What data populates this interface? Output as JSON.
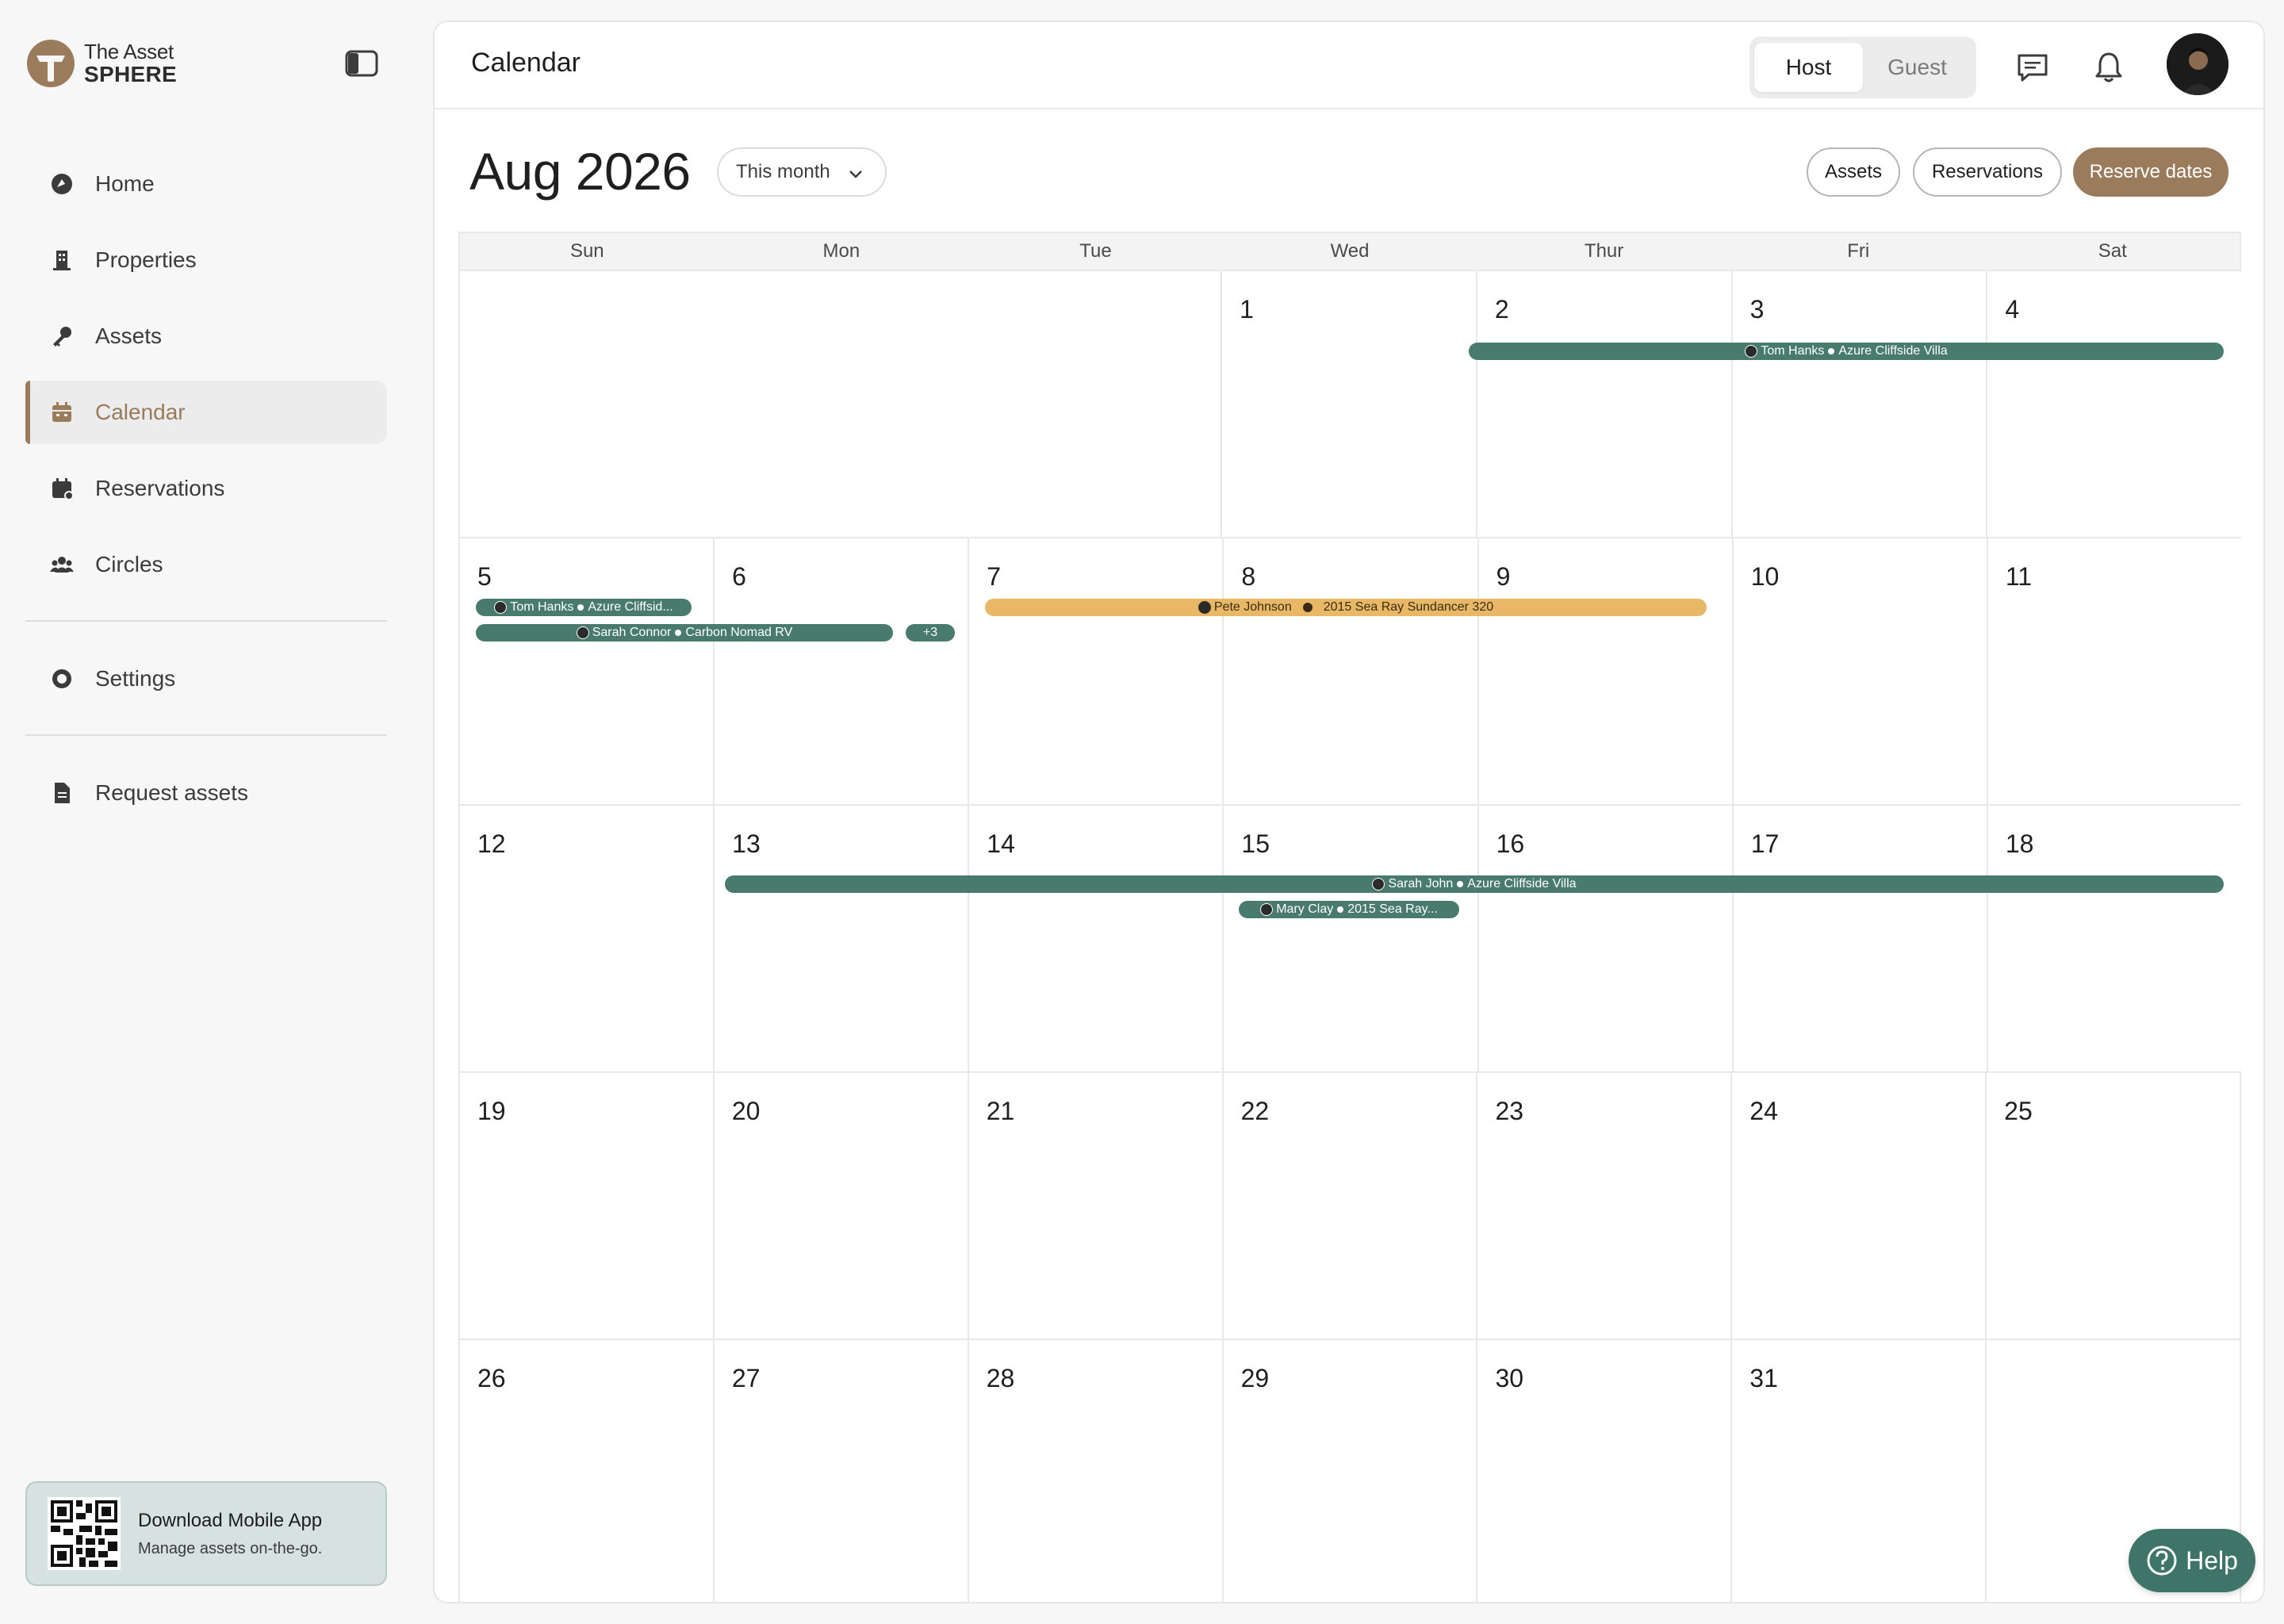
{
  "brand": {
    "line1": "The Asset",
    "line2": "SPHERE",
    "accent": "#9a7b5b"
  },
  "sidebar": {
    "items": [
      {
        "label": "Home",
        "icon": "home-icon"
      },
      {
        "label": "Properties",
        "icon": "building-icon"
      },
      {
        "label": "Assets",
        "icon": "key-icon"
      },
      {
        "label": "Calendar",
        "icon": "calendar-icon",
        "active": true
      },
      {
        "label": "Reservations",
        "icon": "calendar-check-icon"
      },
      {
        "label": "Circles",
        "icon": "users-icon"
      },
      {
        "label": "Settings",
        "icon": "gear-icon"
      },
      {
        "label": "Request assets",
        "icon": "document-icon"
      }
    ],
    "app_card": {
      "title": "Download Mobile App",
      "subtitle": "Manage assets on-the-go."
    }
  },
  "header": {
    "title": "Calendar",
    "mode_toggle": {
      "options": [
        "Host",
        "Guest"
      ],
      "selected": "Host"
    }
  },
  "toolbar": {
    "month_title": "Aug 2026",
    "period_select": "This month",
    "assets_label": "Assets",
    "reservations_label": "Reservations",
    "reserve_label": "Reserve dates"
  },
  "calendar": {
    "weekdays": [
      "Sun",
      "Mon",
      "Tue",
      "Wed",
      "Thur",
      "Fri",
      "Sat"
    ],
    "weeks": [
      [
        "",
        "",
        "",
        "1",
        "2",
        "3",
        "4"
      ],
      [
        "5",
        "6",
        "7",
        "8",
        "9",
        "10",
        "11"
      ],
      [
        "12",
        "13",
        "14",
        "15",
        "16",
        "17",
        "18"
      ],
      [
        "19",
        "20",
        "21",
        "22",
        "23",
        "24",
        "25"
      ],
      [
        "26",
        "27",
        "28",
        "29",
        "30",
        "31",
        ""
      ]
    ],
    "events": [
      {
        "guest": "Tom Hanks",
        "asset": "Azure Cliffside Villa",
        "color": "#487a6e"
      },
      {
        "guest": "Tom Hanks",
        "asset": "Azure Cliffsid...",
        "color": "#487a6e"
      },
      {
        "guest": "Sarah Connor",
        "asset": "Carbon Nomad RV",
        "color": "#487a6e"
      },
      {
        "more": "+3"
      },
      {
        "guest": "Pete Johnson",
        "asset": "2015 Sea Ray Sundancer 320",
        "color": "#e9b866"
      },
      {
        "guest": "Sarah John",
        "asset": "Azure Cliffside Villa",
        "color": "#487a6e"
      },
      {
        "guest": "Mary Clay",
        "asset": "2015 Sea Ray...",
        "color": "#487a6e"
      }
    ]
  },
  "help": {
    "label": "Help"
  }
}
